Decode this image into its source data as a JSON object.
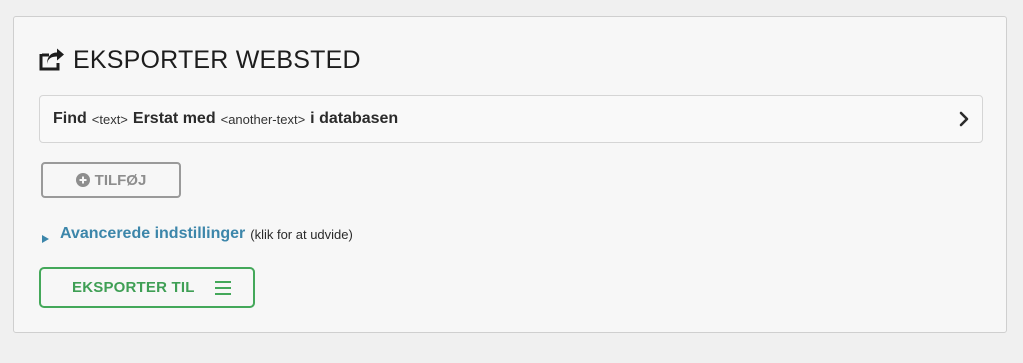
{
  "panel": {
    "title": "EKSPORTER WEBSTED",
    "title_icon": "export-share-icon"
  },
  "replace_rule": {
    "find_label": "Find",
    "find_value": "<text>",
    "replace_label": "Erstat med",
    "replace_value": "<another-text>",
    "scope_label": "i databasen",
    "expand_icon": "chevron-right-icon"
  },
  "add_button": {
    "label": "TILFØJ",
    "icon": "plus-circle-icon"
  },
  "advanced": {
    "label": "Avancerede indstillinger",
    "hint": "(klik for at udvide)",
    "icon": "triangle-right-icon"
  },
  "export_button": {
    "label": "EKSPORTER TIL",
    "icon": "hamburger-menu-icon"
  },
  "colors": {
    "link_blue": "#3c86aa",
    "export_green": "#44a85a",
    "disabled_gray": "#9a9a9a"
  }
}
